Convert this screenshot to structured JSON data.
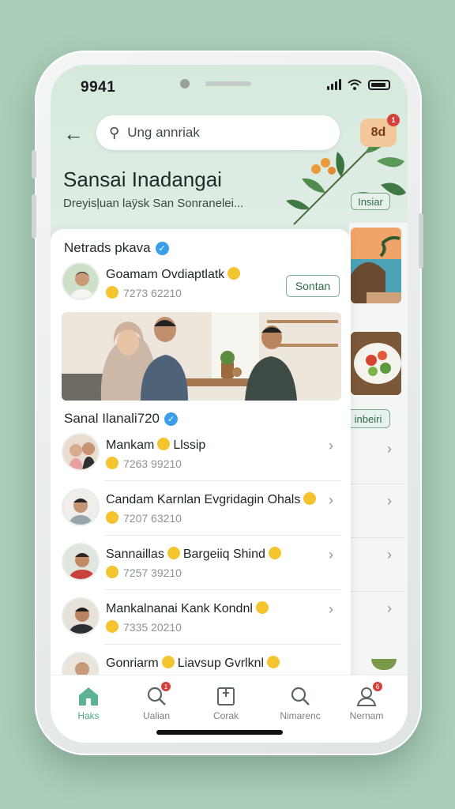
{
  "status": {
    "time": "9941"
  },
  "search": {
    "placeholder": "Ung annriak"
  },
  "notification": {
    "count": "8d",
    "dot": "1"
  },
  "header": {
    "title": "Sansai Inadangai",
    "subtitle": "Dreyisļuan laÿsk San Sonranelei..."
  },
  "background": {
    "tag_button": "Insiar",
    "side_button": "inbeiri"
  },
  "featured": {
    "section_title": "Netrads pkava",
    "profile_name": "Goamam Ovdiaptlatk",
    "profile_meta": "7273 62210",
    "follow_label": "Sontan"
  },
  "list": {
    "section_title": "Sanal Ilanali720",
    "items": [
      {
        "name": "Mankam",
        "name_suffix": "Llssip",
        "meta": "7263 99210"
      },
      {
        "name": "Candam Karnlan Evgridagin Ohals",
        "name_suffix": "",
        "meta": "7207 63210"
      },
      {
        "name": "Sannaillas",
        "name_suffix": "Bargeiiq Shind",
        "meta": "7257 39210"
      },
      {
        "name": "Mankalnanai Kank Kondnl",
        "name_suffix": "",
        "meta": "7335 20210"
      },
      {
        "name": "Gonriarm",
        "name_suffix": "Liavsup Gvrlknl",
        "meta": ""
      }
    ]
  },
  "nav": {
    "items": [
      {
        "label": "Haks",
        "icon": "home-icon",
        "active": true
      },
      {
        "label": "Ualian",
        "icon": "search-icon",
        "badge": "1"
      },
      {
        "label": "Corak",
        "icon": "bookmark-icon"
      },
      {
        "label": "Nimarenc",
        "icon": "search-icon"
      },
      {
        "label": "Nernam",
        "icon": "profile-icon",
        "badge": "6"
      }
    ]
  },
  "colors": {
    "background": "#a9cdb7",
    "accent": "#4ea98a",
    "verified": "#3b9ee8",
    "badge": "#d4403a"
  }
}
